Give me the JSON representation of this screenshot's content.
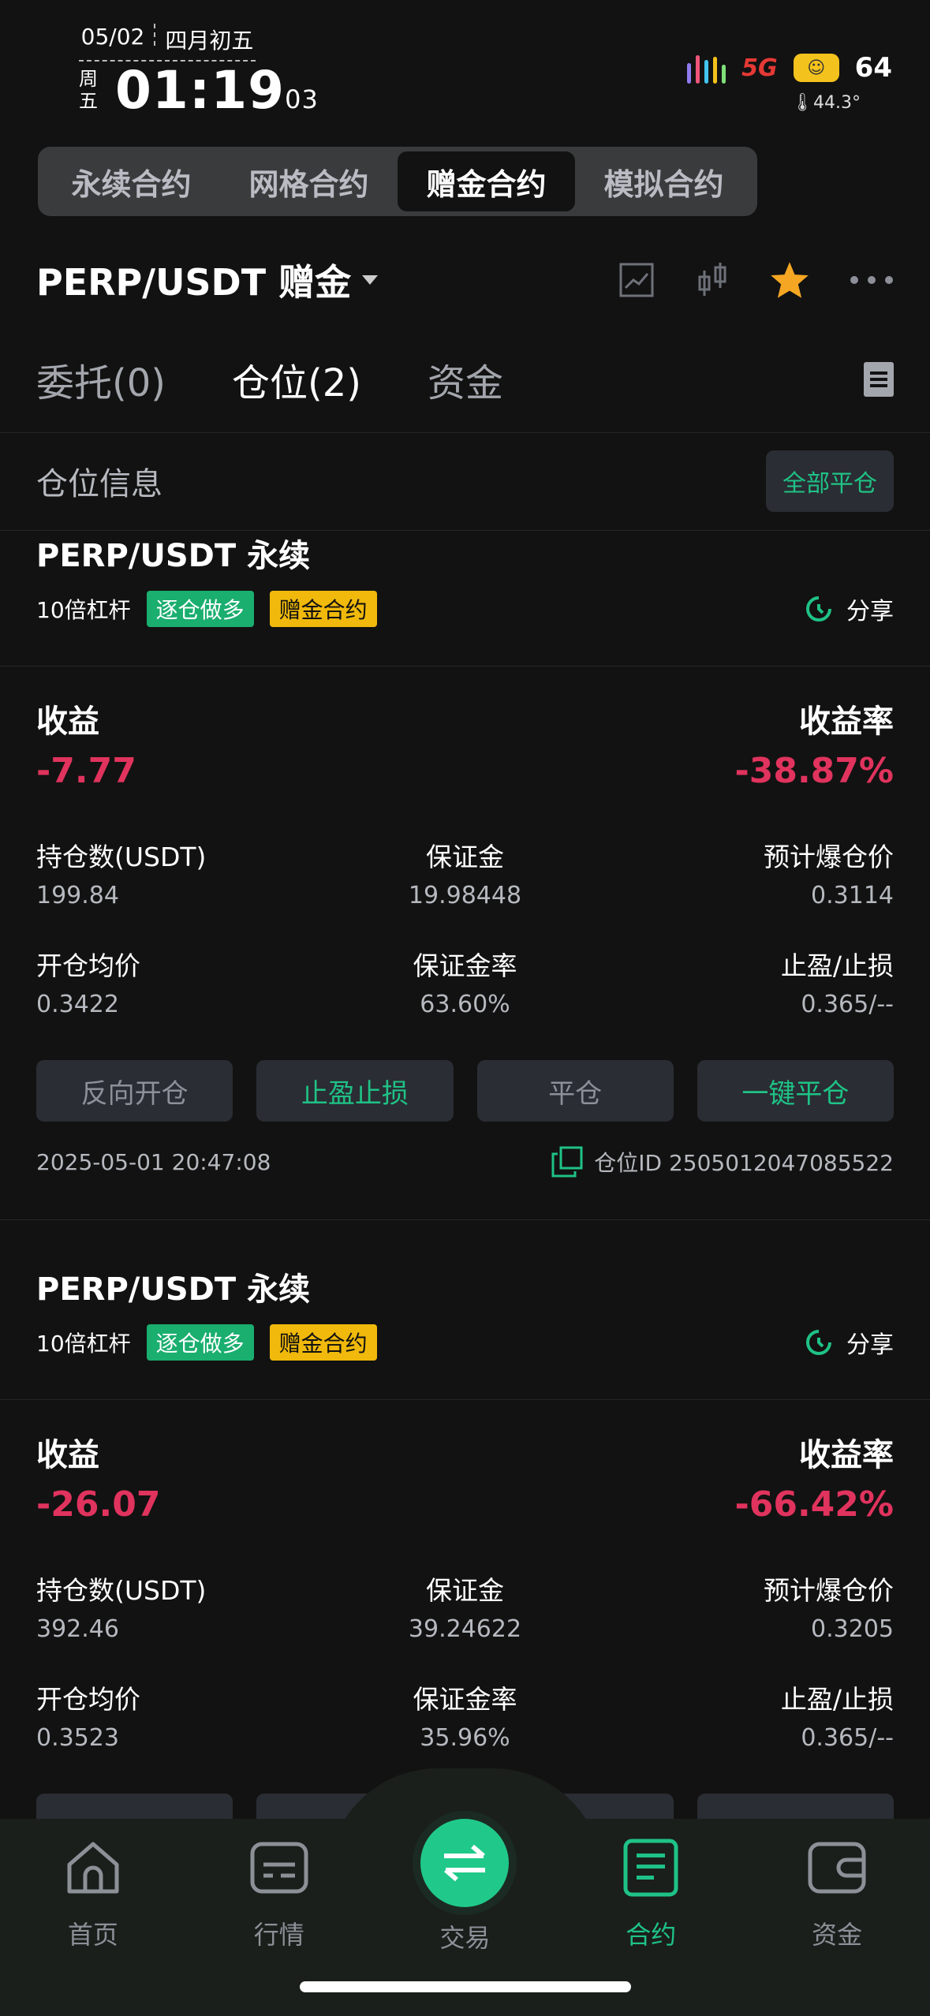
{
  "status_bar": {
    "date": "05/02",
    "lunar": "四月初五",
    "weekday": "周五",
    "time": "01:19",
    "seconds": "03",
    "network": "5G",
    "battery": "64",
    "temperature": "44.3°"
  },
  "segments": [
    "永续合约",
    "网格合约",
    "赠金合约",
    "模拟合约"
  ],
  "pair": {
    "title": "PERP/USDT 赠金"
  },
  "sub_tabs": {
    "orders": "委托(0)",
    "positions": "仓位(2)",
    "funds": "资金"
  },
  "position_info": {
    "label": "仓位信息",
    "close_all": "全部平仓"
  },
  "positions": [
    {
      "title": "PERP/USDT 永续",
      "leverage": "10倍杠杆",
      "tag_mode": "逐仓做多",
      "tag_bonus": "赠金合约",
      "share": "分享",
      "pnl_label": "收益",
      "pnl": "-7.77",
      "roi_label": "收益率",
      "roi": "-38.87%",
      "size_label": "持仓数(USDT)",
      "size": "199.84",
      "margin_label": "保证金",
      "margin": "19.98448",
      "liq_label": "预计爆仓价",
      "liq": "0.3114",
      "entry_label": "开仓均价",
      "entry": "0.3422",
      "margin_rate_label": "保证金率",
      "margin_rate": "63.60%",
      "tpsl_label": "止盈/止损",
      "tpsl": "0.365/--",
      "btn_reverse": "反向开仓",
      "btn_tpsl": "止盈止损",
      "btn_close": "平仓",
      "btn_quick_close": "一键平仓",
      "time": "2025-05-01 20:47:08",
      "pos_id": "仓位ID 2505012047085522"
    },
    {
      "title": "PERP/USDT 永续",
      "leverage": "10倍杠杆",
      "tag_mode": "逐仓做多",
      "tag_bonus": "赠金合约",
      "share": "分享",
      "pnl_label": "收益",
      "pnl": "-26.07",
      "roi_label": "收益率",
      "roi": "-66.42%",
      "size_label": "持仓数(USDT)",
      "size": "392.46",
      "margin_label": "保证金",
      "margin": "39.24622",
      "liq_label": "预计爆仓价",
      "liq": "0.3205",
      "entry_label": "开仓均价",
      "entry": "0.3523",
      "margin_rate_label": "保证金率",
      "margin_rate": "35.96%",
      "tpsl_label": "止盈/止损",
      "tpsl": "0.365/--"
    }
  ],
  "nav": {
    "home": "首页",
    "market": "行情",
    "trade": "交易",
    "contract": "合约",
    "assets": "资金"
  },
  "colors": {
    "accent": "#1fc286",
    "loss": "#e0335d",
    "gold": "#f0b90b",
    "background": "#121212"
  }
}
